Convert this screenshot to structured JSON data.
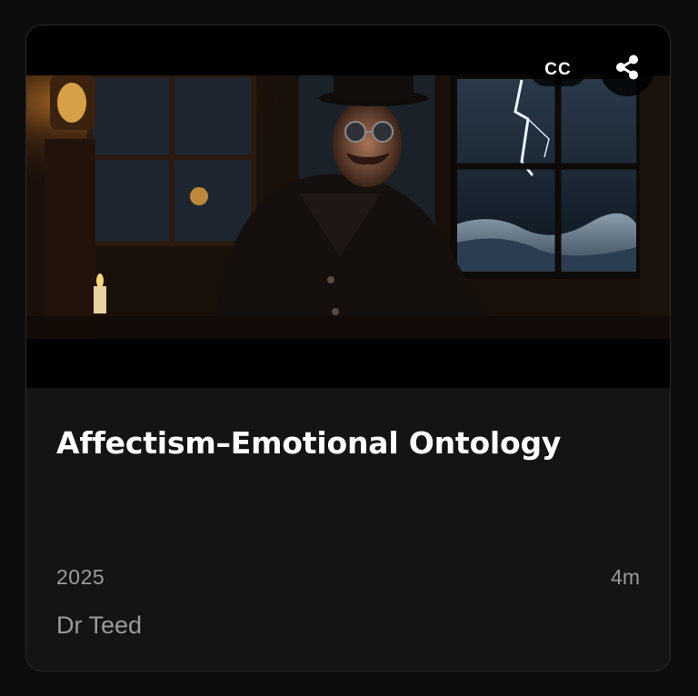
{
  "card": {
    "title": "Affectism–Emotional Ontology",
    "year": "2025",
    "duration": "4m",
    "author": "Dr Teed"
  },
  "thumbnail": {
    "cc_badge": "CC",
    "share_icon": "share-icon"
  },
  "colors": {
    "background": "#0d0d0d",
    "card": "#141414",
    "title": "#ffffff",
    "meta": "#9a9a9a"
  }
}
